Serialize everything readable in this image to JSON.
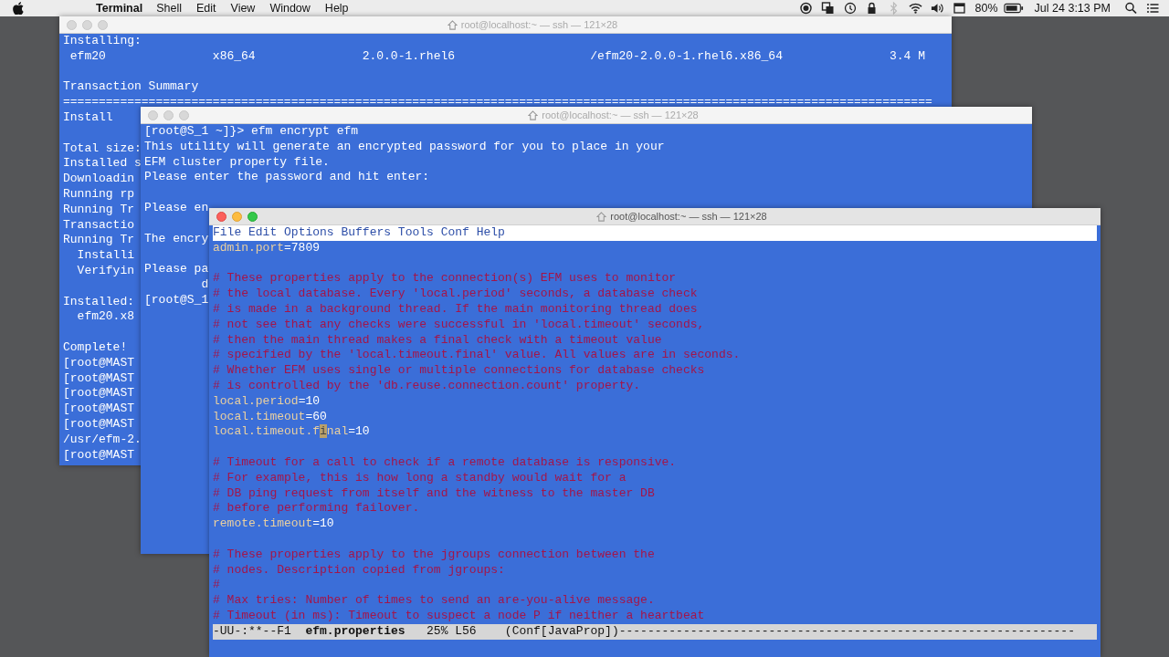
{
  "menu_bar": {
    "app": "Terminal",
    "items": [
      "Shell",
      "Edit",
      "View",
      "Window",
      "Help"
    ],
    "battery": "80%",
    "clock": "Jul 24  3:13 PM"
  },
  "windows": [
    {
      "kind": "terminal",
      "title": "root@localhost:~ — ssh — 121×28",
      "active": false,
      "lines": [
        {
          "kind": "text",
          "text": "Installing:"
        },
        {
          "kind": "text",
          "text": " efm20               x86_64               2.0.0-1.rhel6                   /efm20-2.0.0-1.rhel6.x86_64               3.4 M"
        },
        {
          "kind": "blank"
        },
        {
          "kind": "text",
          "text": "Transaction Summary"
        },
        {
          "kind": "text",
          "text": "=========================================================================================================================="
        },
        {
          "kind": "text",
          "text": "Install"
        },
        {
          "kind": "blank"
        },
        {
          "kind": "text",
          "text": "Total size:"
        },
        {
          "kind": "text",
          "text": "Installed s"
        },
        {
          "kind": "text",
          "text": "Downloadin"
        },
        {
          "kind": "text",
          "text": "Running rp"
        },
        {
          "kind": "text",
          "text": "Running Tr"
        },
        {
          "kind": "text",
          "text": "Transactio"
        },
        {
          "kind": "text",
          "text": "Running Tr"
        },
        {
          "kind": "text",
          "text": "  Installi"
        },
        {
          "kind": "text",
          "text": "  Verifyin"
        },
        {
          "kind": "blank"
        },
        {
          "kind": "text",
          "text": "Installed:"
        },
        {
          "kind": "text",
          "text": "  efm20.x8"
        },
        {
          "kind": "blank"
        },
        {
          "kind": "text",
          "text": "Complete!"
        },
        {
          "kind": "text",
          "text": "[root@MAST"
        },
        {
          "kind": "text",
          "text": "[root@MAST"
        },
        {
          "kind": "text",
          "text": "[root@MAST"
        },
        {
          "kind": "text",
          "text": "[root@MAST"
        },
        {
          "kind": "text",
          "text": "[root@MAST"
        },
        {
          "kind": "text",
          "text": "/usr/efm-2."
        },
        {
          "kind": "text",
          "text": "[root@MAST"
        }
      ]
    },
    {
      "kind": "terminal",
      "title": "root@localhost:~ — ssh — 121×28",
      "active": false,
      "lines": [
        {
          "kind": "text",
          "text": "[root@S_1 ~]}> efm encrypt efm"
        },
        {
          "kind": "text",
          "text": "This utility will generate an encrypted password for you to place in your"
        },
        {
          "kind": "text",
          "text": "EFM cluster property file."
        },
        {
          "kind": "text",
          "text": "Please enter the password and hit enter:"
        },
        {
          "kind": "blank"
        },
        {
          "kind": "text",
          "text": "Please en"
        },
        {
          "kind": "blank"
        },
        {
          "kind": "text",
          "text": "The encry"
        },
        {
          "kind": "blank"
        },
        {
          "kind": "text",
          "text": "Please pa"
        },
        {
          "kind": "text",
          "text": "        d"
        },
        {
          "kind": "text",
          "text": "[root@S_1"
        }
      ]
    },
    {
      "kind": "emacs",
      "title": "root@localhost:~ — ssh — 121×28",
      "active": true,
      "menu": [
        "File",
        "Edit",
        "Options",
        "Buffers",
        "Tools",
        "Conf",
        "Help"
      ],
      "lines": [
        {
          "kind": "property",
          "key": "admin.port",
          "value": "=7809"
        },
        {
          "kind": "blank"
        },
        {
          "kind": "comment",
          "text": "# These properties apply to the connection(s) EFM uses to monitor"
        },
        {
          "kind": "comment",
          "text": "# the local database. Every 'local.period' seconds, a database check"
        },
        {
          "kind": "comment",
          "text": "# is made in a background thread. If the main monitoring thread does"
        },
        {
          "kind": "comment",
          "text": "# not see that any checks were successful in 'local.timeout' seconds,"
        },
        {
          "kind": "comment",
          "text": "# then the main thread makes a final check with a timeout value"
        },
        {
          "kind": "comment",
          "text": "# specified by the 'local.timeout.final' value. All values are in seconds."
        },
        {
          "kind": "comment",
          "text": "# Whether EFM uses single or multiple connections for database checks"
        },
        {
          "kind": "comment",
          "text": "# is controlled by the 'db.reuse.connection.count' property."
        },
        {
          "kind": "property",
          "key": "local.period",
          "value": "=10"
        },
        {
          "kind": "property",
          "key": "local.timeout",
          "value": "=60"
        },
        {
          "kind": "property",
          "key": "local.timeout.f",
          "cursor": "i",
          "key_rest": "nal",
          "value": "=10"
        },
        {
          "kind": "blank"
        },
        {
          "kind": "comment",
          "text": "# Timeout for a call to check if a remote database is responsive."
        },
        {
          "kind": "comment",
          "text": "# For example, this is how long a standby would wait for a"
        },
        {
          "kind": "comment",
          "text": "# DB ping request from itself and the witness to the master DB"
        },
        {
          "kind": "comment",
          "text": "# before performing failover."
        },
        {
          "kind": "property",
          "key": "remote.timeout",
          "value": "=10"
        },
        {
          "kind": "blank"
        },
        {
          "kind": "comment",
          "text": "# These properties apply to the jgroups connection between the"
        },
        {
          "kind": "comment",
          "text": "# nodes. Description copied from jgroups:"
        },
        {
          "kind": "comment",
          "text": "#"
        },
        {
          "kind": "comment",
          "text": "# Max tries: Number of times to send an are-you-alive message."
        },
        {
          "kind": "comment",
          "text": "# Timeout (in ms): Timeout to suspect a node P if neither a heartbeat"
        }
      ],
      "mode_line": [
        {
          "text": "-UU-:**--F1  ",
          "bold": false
        },
        {
          "text": "efm.properties",
          "bold": true
        },
        {
          "text": "   25% L56    (Conf[JavaProp])----------------------------------------------------------------",
          "bold": false
        }
      ]
    }
  ]
}
